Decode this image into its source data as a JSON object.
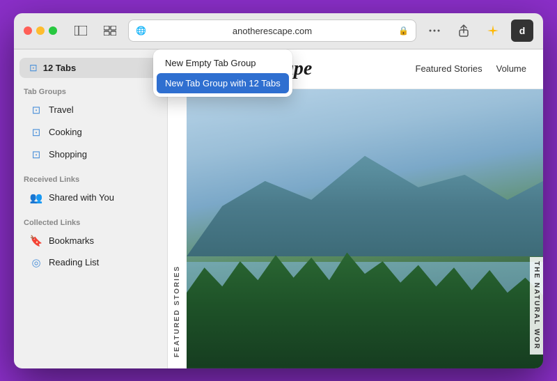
{
  "window": {
    "title": "Another Escape"
  },
  "toolbar": {
    "url": "anotherescape.com",
    "traffic_lights": [
      "red",
      "yellow",
      "green"
    ]
  },
  "dropdown": {
    "items": [
      {
        "label": "New Empty Tab Group",
        "highlighted": false
      },
      {
        "label": "New Tab Group with 12 Tabs",
        "highlighted": true
      }
    ]
  },
  "sidebar": {
    "current_tab_label": "12 Tabs",
    "tab_groups_header": "Tab Groups",
    "tab_group_items": [
      {
        "label": "Travel"
      },
      {
        "label": "Cooking"
      },
      {
        "label": "Shopping"
      }
    ],
    "received_links_header": "Received Links",
    "received_links_item": "Shared with You",
    "collected_links_header": "Collected Links",
    "collected_links_items": [
      {
        "label": "Bookmarks"
      },
      {
        "label": "Reading List"
      }
    ]
  },
  "site": {
    "title": "Another Escape",
    "nav_links": [
      "Featured Stories",
      "Volume"
    ]
  },
  "featured_label": "FEATURED STORIES",
  "side_label_right": "THE NATURAL WOR"
}
